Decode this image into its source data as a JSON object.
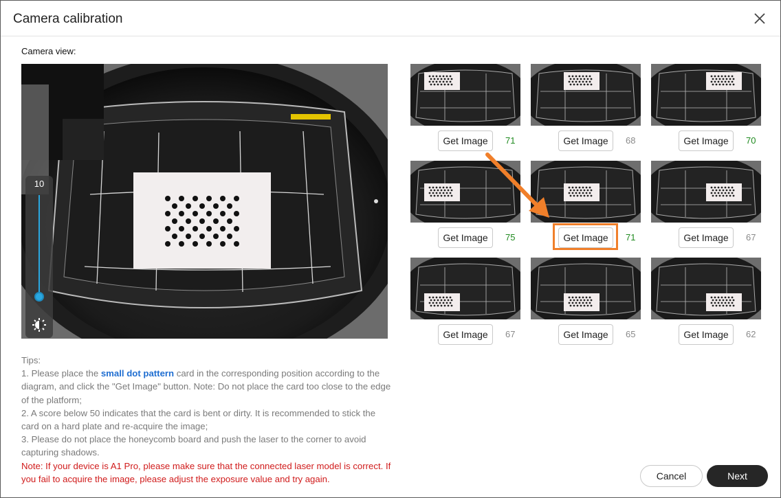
{
  "dialog": {
    "title": "Camera calibration",
    "close_icon": "close-icon"
  },
  "camera": {
    "label": "Camera view:",
    "exposure_value": "10",
    "brightness_icon": "brightness-icon"
  },
  "thumbnails": [
    {
      "button": "Get Image",
      "score": "71",
      "score_status": "good",
      "card_pos": "left-top"
    },
    {
      "button": "Get Image",
      "score": "68",
      "score_status": "gray",
      "card_pos": "center-top"
    },
    {
      "button": "Get Image",
      "score": "70",
      "score_status": "good",
      "card_pos": "right-top"
    },
    {
      "button": "Get Image",
      "score": "75",
      "score_status": "good",
      "card_pos": "left-mid"
    },
    {
      "button": "Get Image",
      "score": "71",
      "score_status": "good",
      "card_pos": "center-mid"
    },
    {
      "button": "Get Image",
      "score": "67",
      "score_status": "gray",
      "card_pos": "right-mid"
    },
    {
      "button": "Get Image",
      "score": "67",
      "score_status": "gray",
      "card_pos": "left-bottom"
    },
    {
      "button": "Get Image",
      "score": "65",
      "score_status": "gray",
      "card_pos": "center-bottom"
    },
    {
      "button": "Get Image",
      "score": "62",
      "score_status": "gray",
      "card_pos": "right-bottom"
    }
  ],
  "tips": {
    "heading": "Tips:",
    "line1_pre": "1. Please place the ",
    "line1_highlight": "small dot pattern",
    "line1_post": " card in the corresponding position according to the diagram, and click the \"Get Image\" button. Note: Do not place the card too close to the edge of the platform;",
    "line2": "2. A score below 50 indicates that the card is bent or dirty. It is recommended to stick the card on a hard plate and re-acquire the image;",
    "line3": "3. Please do not place the honeycomb board and push the laser to the corner to avoid capturing shadows.",
    "note": "Note: If your device is A1 Pro, please make sure that the connected laser model is correct. If you fail to acquire the image, please adjust the exposure value and try again."
  },
  "footer": {
    "cancel": "Cancel",
    "next": "Next"
  },
  "colors": {
    "accent": "#f07f2a",
    "good_score": "#1f8a1f",
    "gray_score": "#8a8a8a",
    "highlight_text": "#1f6ed1",
    "note_text": "#d01b1b",
    "primary_button": "#262626"
  }
}
